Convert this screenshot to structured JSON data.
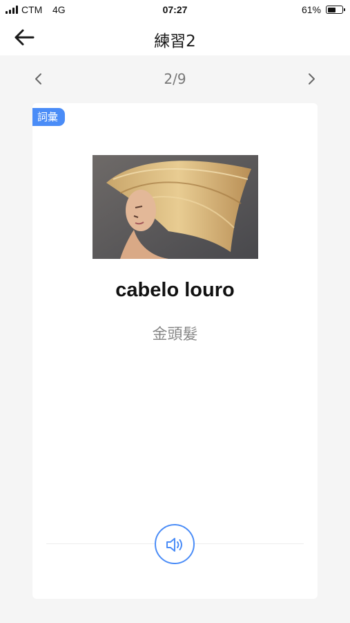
{
  "status_bar": {
    "carrier": "CTM",
    "network": "4G",
    "time": "07:27",
    "battery_percent_label": "61%",
    "battery_level": 0.61
  },
  "header": {
    "title": "練習2",
    "back_icon": "back-arrow-icon"
  },
  "pager": {
    "position": "2/9",
    "prev_icon": "chevron-left-icon",
    "next_icon": "chevron-right-icon"
  },
  "card": {
    "tag": "詞彙",
    "word": "cabelo louro",
    "translation": "金頭髮",
    "audio_icon": "speaker-icon"
  },
  "colors": {
    "accent": "#4a8cf7",
    "background": "#f5f5f5",
    "card": "#ffffff"
  }
}
